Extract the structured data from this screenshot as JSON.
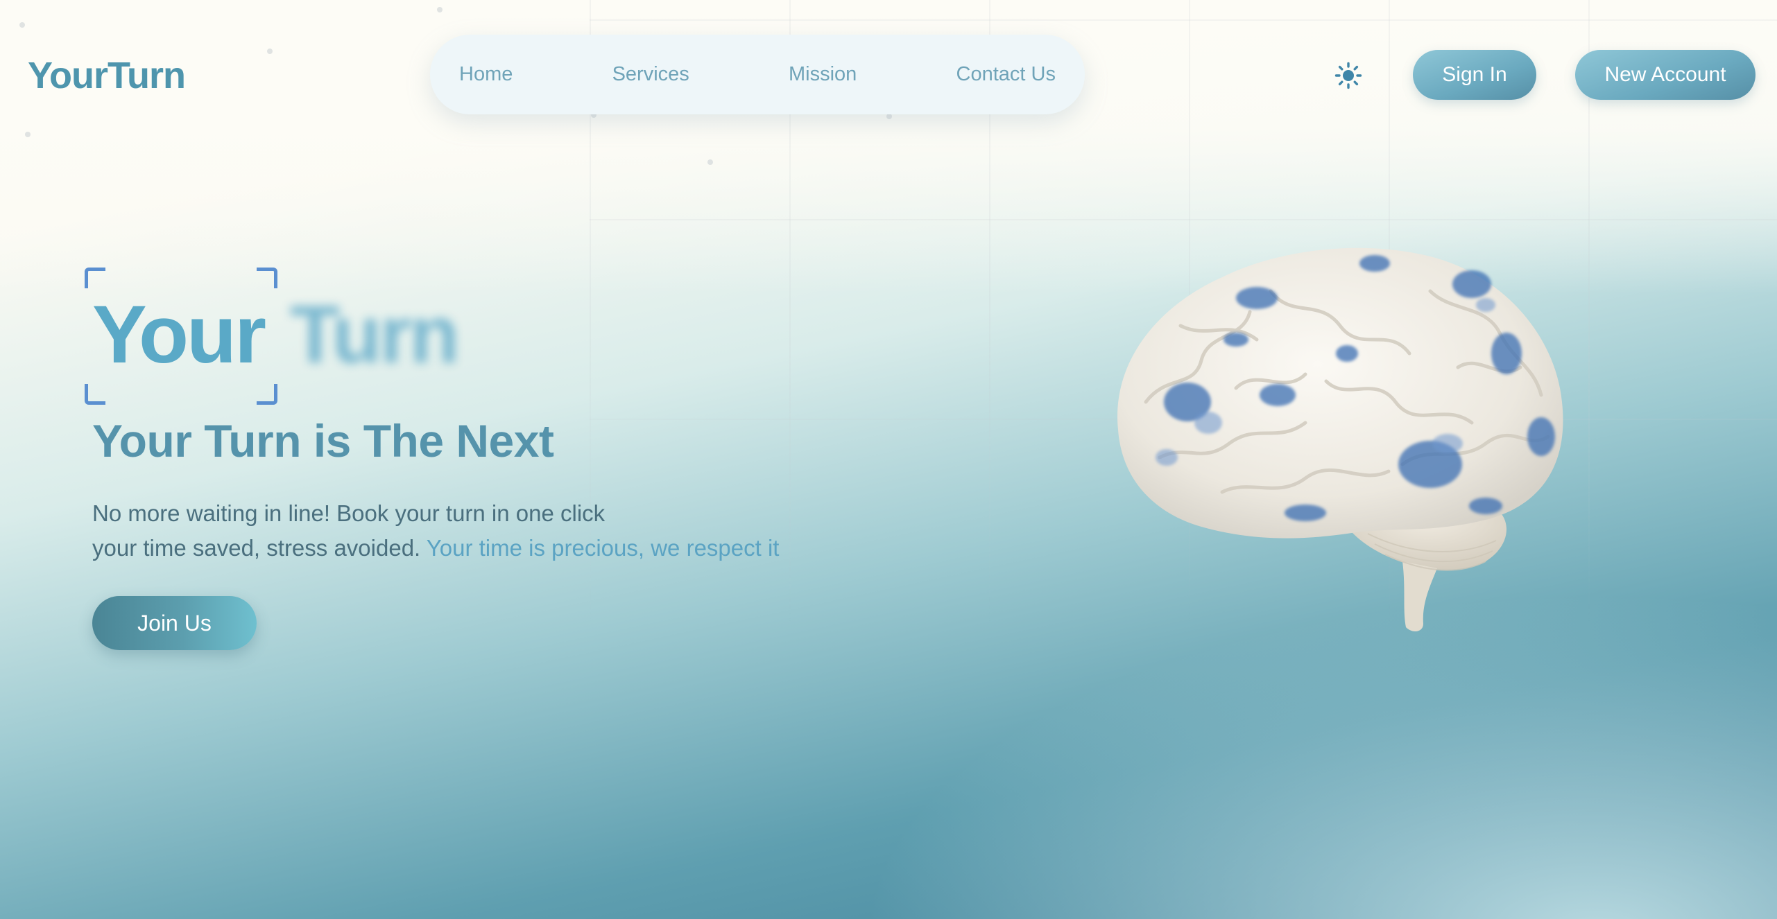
{
  "brand": {
    "logo": "YourTurn"
  },
  "nav": {
    "items": [
      {
        "label": "Home"
      },
      {
        "label": "Services"
      },
      {
        "label": "Mission"
      },
      {
        "label": "Contact Us"
      }
    ]
  },
  "header": {
    "theme_icon": "sun-icon",
    "sign_in": "Sign In",
    "new_account": "New Account"
  },
  "hero": {
    "word_1": "Your",
    "word_2": "Turn",
    "subtitle": "Your Turn is The Next",
    "desc_line1": "No more waiting in line! Book your turn in one click",
    "desc_line2": "your time saved, stress avoided.",
    "desc_accent": "Your time is precious, we respect it",
    "cta": "Join Us",
    "image_icon": "brain-illustration"
  },
  "colors": {
    "brand": "#4e95ad",
    "accent": "#5ba3c3",
    "button": "#6aa9bf",
    "nav_bg": "#eef6f9",
    "text": "#4a6f7e"
  }
}
